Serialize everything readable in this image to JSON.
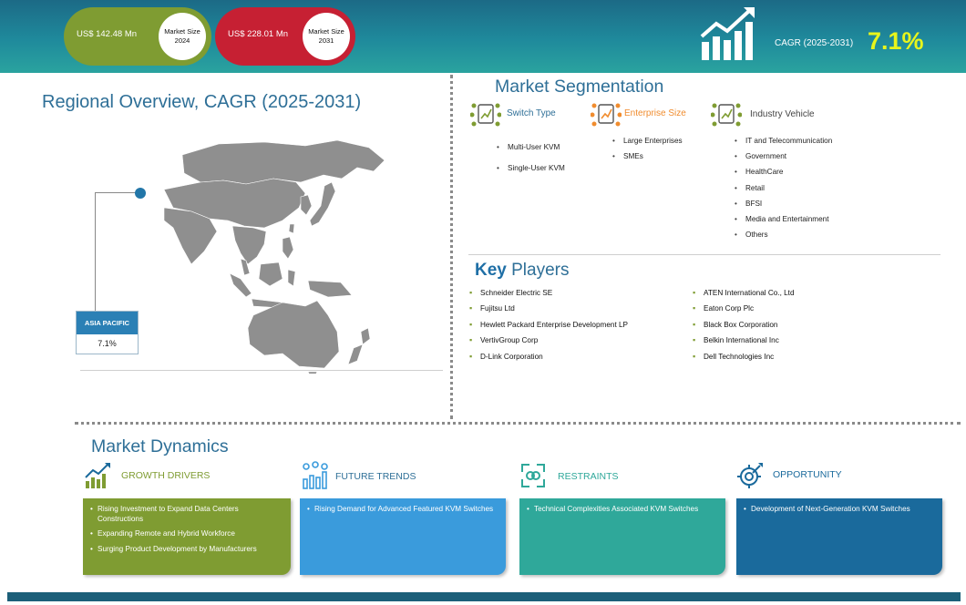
{
  "header": {
    "market_2024": {
      "value": "US$ 142.48 Mn",
      "label_line1": "Market Size",
      "label_line2": "2024"
    },
    "market_2031": {
      "value": "US$ 228.01 Mn",
      "label_line1": "Market Size",
      "label_line2": "2031"
    },
    "cagr_label": "CAGR (2025-2031)",
    "cagr_value": "7.1%",
    "cagr_icon": "growth-bar-chart-icon"
  },
  "regional": {
    "title": "Regional Overview, CAGR (2025-2031)",
    "region_name": "ASIA PACIFIC",
    "region_cagr": "7.1%"
  },
  "segmentation": {
    "title": "Market Segmentation",
    "switch_type": {
      "heading": "Switch Type",
      "items": [
        "Multi-User KVM",
        "Single-User KVM"
      ]
    },
    "enterprise_size": {
      "heading": "Enterprise Size",
      "items": [
        "Large Enterprises",
        "SMEs"
      ]
    },
    "industry_vehicle": {
      "heading": "Industry Vehicle",
      "items": [
        "IT and Telecommunication",
        "Government",
        "HealthCare",
        "Retail",
        "BFSI",
        "Media and Entertainment",
        "Others"
      ]
    }
  },
  "key_players": {
    "title_key": "Key",
    "title_rest": " Players",
    "left": [
      "Schneider Electric SE",
      "Fujitsu Ltd",
      "Hewlett Packard Enterprise Development LP",
      "VertivGroup Corp",
      "D-Link Corporation"
    ],
    "right": [
      "ATEN International Co., Ltd",
      "Eaton Corp Plc",
      "Black Box Corporation",
      "Belkin International Inc",
      "Dell Technologies Inc"
    ]
  },
  "dynamics": {
    "title": "Market Dynamics",
    "growth_drivers": {
      "heading": "GROWTH DRIVERS",
      "items": [
        "Rising Investment to Expand Data Centers Constructions",
        "Expanding Remote and Hybrid Workforce",
        "Surging Product Development by Manufacturers"
      ]
    },
    "future_trends": {
      "heading": "FUTURE TRENDS",
      "items": [
        "Rising Demand for Advanced Featured KVM Switches"
      ]
    },
    "restraints": {
      "heading": "RESTRAINTS",
      "items": [
        "Technical Complexities Associated KVM Switches"
      ]
    },
    "opportunity": {
      "heading": "OPPORTUNITY",
      "items": [
        "Development of Next-Generation KVM Switches"
      ]
    }
  },
  "colors": {
    "green": "#7f9c32",
    "red": "#c62033",
    "blue": "#3a9bdc",
    "teal": "#2fa89a",
    "navy": "#1a6a9c",
    "cagr_yellow": "#e8f51c",
    "title_blue": "#2e6f97"
  }
}
